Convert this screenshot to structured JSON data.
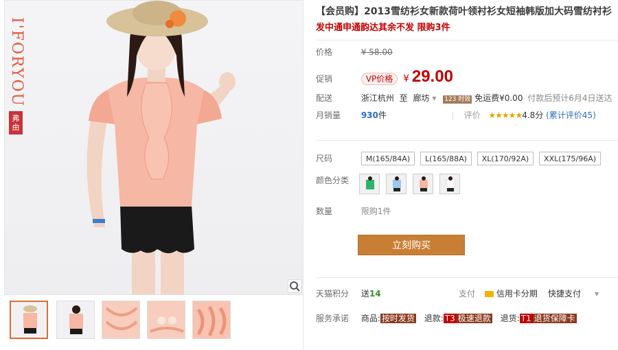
{
  "gallery": {
    "brand_text": "I'FORYOU",
    "brand_tag": "弗由",
    "thumbs": 5
  },
  "product": {
    "title": "【会员购】2013雪纺衫女新款荷叶领衬衫女短袖韩版加大码雪纺衬衫",
    "subtitle": "发中通申通韵达其余不发 限购3件",
    "price_label": "价格",
    "price_old": "¥ 58.00",
    "promo_label": "促销",
    "vip_label": "VP价格",
    "yen": "¥",
    "price_now": "29.00",
    "delivery_label": "配送",
    "delivery_from": "浙江杭州",
    "delivery_to_word": "至",
    "delivery_to": "廊坊",
    "delivery_tag": "123 时效",
    "delivery_fee": "免运费¥0.00",
    "delivery_note": "付款后预计6月4日送达",
    "sales_label": "月销量",
    "sales_count": "930",
    "sales_unit": "件",
    "rating_label": "评价",
    "stars": "★★★★★",
    "rating_score": "4.8分",
    "rating_count": "(累计评价45)",
    "size_label": "尺码",
    "sizes": [
      "M(165/84A)",
      "L(165/88A)",
      "XL(170/92A)",
      "XXL(175/96A)"
    ],
    "color_label": "颜色分类",
    "qty_label": "数量",
    "qty_limit": "限购1件",
    "buy_label": "立刻购买",
    "points_label": "天猫积分",
    "points_give": "送",
    "points_value": "14",
    "pay_label": "支付",
    "pay_card": "信用卡分期",
    "pay_quick": "快捷支付",
    "service_label": "服务承诺",
    "svc_goods": "商品:",
    "svc_goods_tag": "按时发货",
    "svc_refund": "退款:",
    "svc_refund_tag_code": "T3",
    "svc_refund_tag": "极速退款",
    "svc_return": "退货:",
    "svc_return_tag_code": "T1",
    "svc_return_tag": "退货保障卡"
  },
  "colors": {
    "price": "#c40000",
    "buy_button": "#c87f35",
    "blouse": "#f6b7a4"
  }
}
